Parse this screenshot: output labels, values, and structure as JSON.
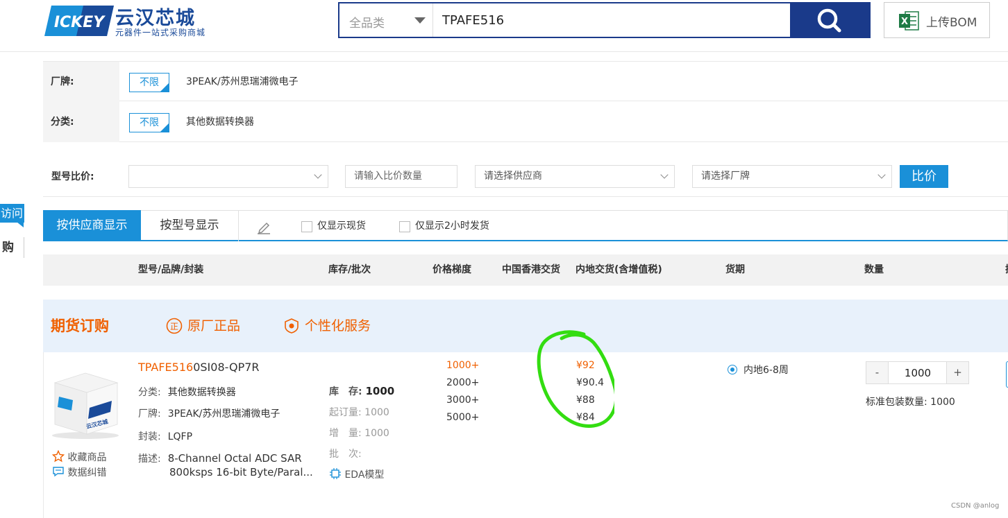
{
  "header": {
    "logo_title": "云汉芯城",
    "logo_sub": "元器件一站式采购商城",
    "search_category": "全品类",
    "search_value": "TPAFE516",
    "bom_label": "上传BOM"
  },
  "side": {
    "visit": "访问",
    "buy": "购"
  },
  "filters": [
    {
      "label": "厂牌:",
      "unlimit": "不限",
      "value": "3PEAK/苏州思瑞浦微电子"
    },
    {
      "label": "分类:",
      "unlimit": "不限",
      "value": "其他数据转换器"
    }
  ],
  "compare": {
    "label": "型号比价:",
    "model_select": "",
    "qty_placeholder": "请输入比价数量",
    "supplier_select": "请选择供应商",
    "brand_select": "请选择厂牌",
    "button": "比价"
  },
  "tabs": {
    "supplier": "按供应商显示",
    "model": "按型号显示",
    "only_stock": "仅显示现货",
    "only_2h": "仅显示2小时发货"
  },
  "columns": {
    "model": "型号/品牌/封装",
    "stock": "库存/批次",
    "price_tier": "价格梯度",
    "hk": "中国香港交货",
    "mainland": "内地交货(含增值税)",
    "lead": "货期",
    "qty": "数量",
    "cut": "操"
  },
  "banner": {
    "title": "期货订购",
    "genuine": "原厂正品",
    "service": "个性化服务"
  },
  "product": {
    "pn_highlight": "TPAFE516",
    "pn_rest": "0SI08-QP7R",
    "category_label": "分类:",
    "category": "其他数据转换器",
    "brand_label": "厂牌:",
    "brand": "3PEAK/苏州思瑞浦微电子",
    "package_label": "封装:",
    "package": "LQFP",
    "desc_label": "描述:",
    "desc_line1": "8-Channel Octal ADC SAR",
    "desc_line2": "800ksps 16-bit Byte/Paral...",
    "favorite": "收藏商品",
    "report": "数据纠错",
    "stock_label": "库　存:",
    "stock_value": "1000",
    "moq": "起订量:  1000",
    "increment": "增　量:  1000",
    "batch": "批　次:",
    "eda": "EDA模型",
    "tiers": [
      "1000+",
      "2000+",
      "3000+",
      "5000+"
    ],
    "prices": [
      "¥92",
      "¥90.4",
      "¥88",
      "¥84"
    ],
    "delivery": "内地6-8周",
    "qty_minus": "-",
    "qty_value": "1000",
    "qty_plus": "+",
    "pack": "标准包装数量: 1000",
    "img_text": "云汉芯城"
  },
  "colors": {
    "accent": "#1a90d8",
    "navy": "#1a3a8a",
    "orange": "#f06000",
    "annotation": "#33dd11"
  },
  "watermark": "CSDN @anlog"
}
